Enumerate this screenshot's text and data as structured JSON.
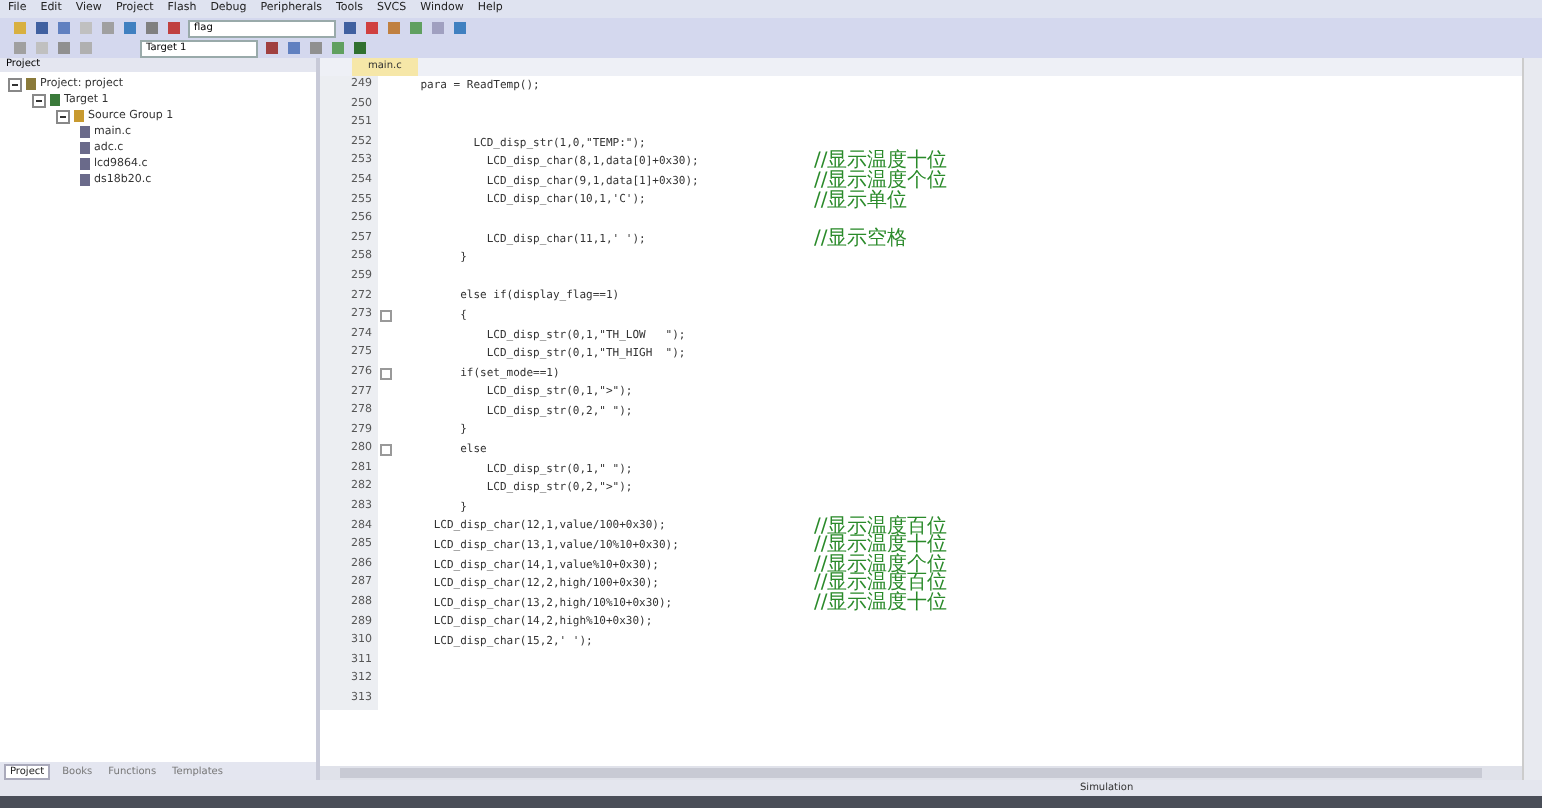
{
  "menu": [
    "File",
    "Edit",
    "View",
    "Project",
    "Flash",
    "Debug",
    "Peripherals",
    "Tools",
    "SVCS",
    "Window",
    "Help"
  ],
  "toolbar": {
    "find_value": "flag",
    "target": "Target 1"
  },
  "project_panel": {
    "title": "Project",
    "tree": [
      {
        "label": "Project: project",
        "expanded": true,
        "kind": "project",
        "children": [
          {
            "label": "Target 1",
            "expanded": true,
            "kind": "target",
            "children": [
              {
                "label": "Source Group 1",
                "expanded": true,
                "kind": "group",
                "children": [
                  {
                    "label": "main.c",
                    "kind": "file"
                  },
                  {
                    "label": "adc.c",
                    "kind": "file"
                  },
                  {
                    "label": "lcd9864.c",
                    "kind": "file"
                  },
                  {
                    "label": "ds18b20.c",
                    "kind": "file"
                  }
                ]
              }
            ]
          }
        ]
      }
    ],
    "tabs": [
      {
        "label": "Project",
        "selected": true
      },
      {
        "label": "Books",
        "selected": false
      },
      {
        "label": "Functions",
        "selected": false
      },
      {
        "label": "Templates",
        "selected": false
      }
    ]
  },
  "editor": {
    "tabs": [
      {
        "label": "main.c",
        "selected": true
      }
    ],
    "lines": [
      {
        "number": "249",
        "code": "    para = ReadTemp();"
      },
      {
        "number": "250"
      },
      {
        "number": "251"
      },
      {
        "number": "252",
        "code": "            LCD_disp_str(1,0,\"TEMP:\");"
      },
      {
        "number": "253",
        "code": "              LCD_disp_char(8,1,data[0]+0x30);",
        "comment": "//显示温度十位"
      },
      {
        "number": "254",
        "code": "              LCD_disp_char(9,1,data[1]+0x30);",
        "comment": "//显示温度个位"
      },
      {
        "number": "255",
        "code": "              LCD_disp_char(10,1,'C');",
        "comment": "//显示单位"
      },
      {
        "number": "256"
      },
      {
        "number": "257",
        "code": "              LCD_disp_char(11,1,' ');",
        "comment": "//显示空格"
      },
      {
        "number": "258",
        "code": "          }"
      },
      {
        "number": "259"
      },
      {
        "number": "272",
        "code": "          else if(display_flag==1)"
      },
      {
        "number": "273",
        "code": "          {",
        "fold": true
      },
      {
        "number": "274",
        "code": "              LCD_disp_str(0,1,\"TH_LOW   \");"
      },
      {
        "number": "275",
        "code": "              LCD_disp_str(0,1,\"TH_HIGH  \");"
      },
      {
        "number": "276",
        "code": "          if(set_mode==1)",
        "fold": true
      },
      {
        "number": "277",
        "code": "              LCD_disp_str(0,1,\">\");"
      },
      {
        "number": "278",
        "code": "              LCD_disp_str(0,2,\" \");"
      },
      {
        "number": "279",
        "code": "          }"
      },
      {
        "number": "280",
        "code": "          else",
        "fold": true
      },
      {
        "number": "281",
        "code": "              LCD_disp_str(0,1,\" \");"
      },
      {
        "number": "282",
        "code": "              LCD_disp_str(0,2,\">\");"
      },
      {
        "number": "283",
        "code": "          }"
      },
      {
        "number": "284",
        "code": "      LCD_disp_char(12,1,value/100+0x30);",
        "comment": "//显示温度百位"
      },
      {
        "number": "285",
        "code": "      LCD_disp_char(13,1,value/10%10+0x30);",
        "comment": "//显示温度十位"
      },
      {
        "number": "286",
        "code": "      LCD_disp_char(14,1,value%10+0x30);",
        "comment": "//显示温度个位"
      },
      {
        "number": "287",
        "code": "      LCD_disp_char(12,2,high/100+0x30);",
        "comment": "//显示温度百位"
      },
      {
        "number": "288",
        "code": "      LCD_disp_char(13,2,high/10%10+0x30);",
        "comment": "//显示温度十位"
      },
      {
        "number": "289",
        "code": "      LCD_disp_char(14,2,high%10+0x30);"
      },
      {
        "number": "310",
        "code": "      LCD_disp_char(15,2,' ');"
      },
      {
        "number": "311"
      },
      {
        "number": "312"
      },
      {
        "number": "313"
      }
    ]
  },
  "status_bar": {
    "mode": "Simulation"
  }
}
